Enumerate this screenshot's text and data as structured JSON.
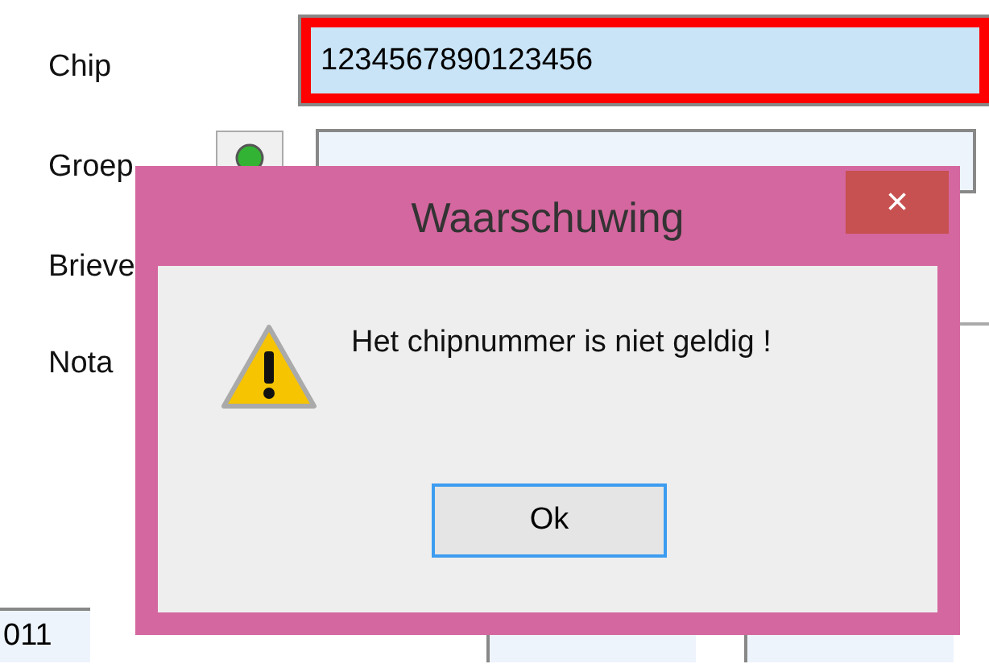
{
  "form": {
    "fields": [
      {
        "label": "Chip",
        "value": "1234567890123456",
        "invalid": true
      },
      {
        "label": "Groep",
        "invalid": false
      },
      {
        "label": "Brieve"
      },
      {
        "label": "Nota"
      }
    ],
    "bottom_row": {
      "field_1": "011"
    }
  },
  "dialog": {
    "title": "Waarschuwing",
    "close": "×",
    "message": "Het chipnummer is niet geldig !",
    "button": "Ok"
  }
}
